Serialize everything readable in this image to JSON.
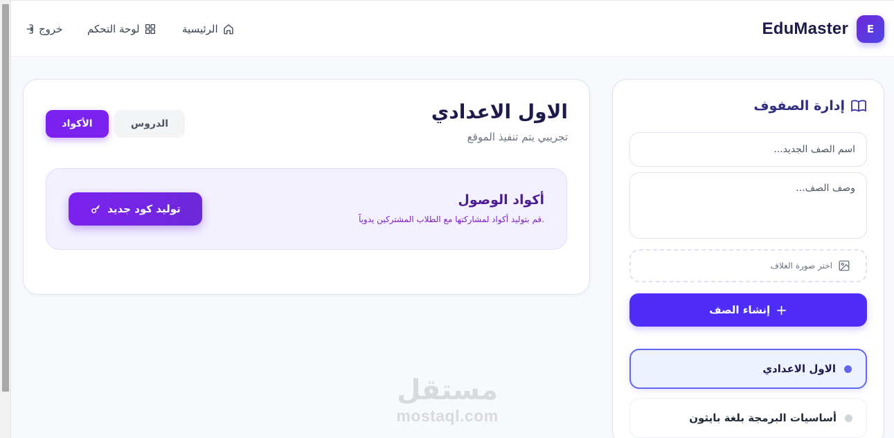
{
  "app": {
    "brand_letter": "E",
    "brand_name": "EduMaster",
    "accent_color": "#7c22f0",
    "primary_color": "#4f2cf7"
  },
  "nav": {
    "home": {
      "label": "الرئيسية",
      "icon": "home-icon"
    },
    "dashboard": {
      "label": "لوحة التحكم",
      "icon": "grid-icon"
    },
    "logout": {
      "label": "خروج",
      "icon": "logout-icon"
    }
  },
  "sidebar": {
    "title": "إدارة الصفوف",
    "title_icon": "book-open-icon",
    "name_placeholder": "اسم الصف الجديد...",
    "desc_placeholder": "وصف الصف...",
    "cover_label": "اختر صورة الغلاف",
    "cover_icon": "image-icon",
    "create_label": "إنشاء الصف",
    "create_icon": "plus-icon",
    "classes": [
      {
        "label": "الاول الاعدادي",
        "active": true
      },
      {
        "label": "أساسيات البرمجة بلغة بايثون",
        "active": false
      }
    ]
  },
  "main": {
    "class_title": "الاول الاعدادي",
    "class_subtitle": "تجريبي يتم تنفيذ الموقع",
    "tabs": [
      {
        "label": "الأكواد",
        "active": true
      },
      {
        "label": "الدروس",
        "active": false
      }
    ],
    "codes": {
      "title": "أكواد الوصول",
      "description": "قم بتوليد أكواد لمشاركتها مع الطلاب المشتركين يدوياً.",
      "generate_label": "توليد كود جديد",
      "generate_icon": "key-icon"
    }
  },
  "watermark": {
    "arabic": "مستقل",
    "latin": "mostaql.com"
  }
}
